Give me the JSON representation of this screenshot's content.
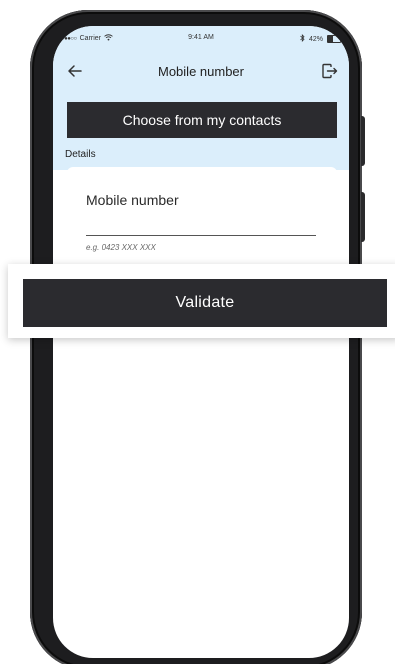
{
  "status_bar": {
    "carrier": "Carrier",
    "time": "9:41 AM",
    "battery_percent": "42%",
    "battery_level": 0.42
  },
  "nav": {
    "title": "Mobile number",
    "back_icon": "arrow-left-icon",
    "logout_icon": "logout-icon"
  },
  "contacts_button": {
    "label": "Choose from my contacts"
  },
  "details": {
    "section_label": "Details",
    "field_label": "Mobile number",
    "field_value": "",
    "hint": "e.g. 0423 XXX XXX"
  },
  "validate_button": {
    "label": "Validate"
  },
  "colors": {
    "header_background": "#dbeefb",
    "button_background": "#2b2b2f",
    "button_text": "#ffffff",
    "phone_frame": "#1d1d1f"
  }
}
